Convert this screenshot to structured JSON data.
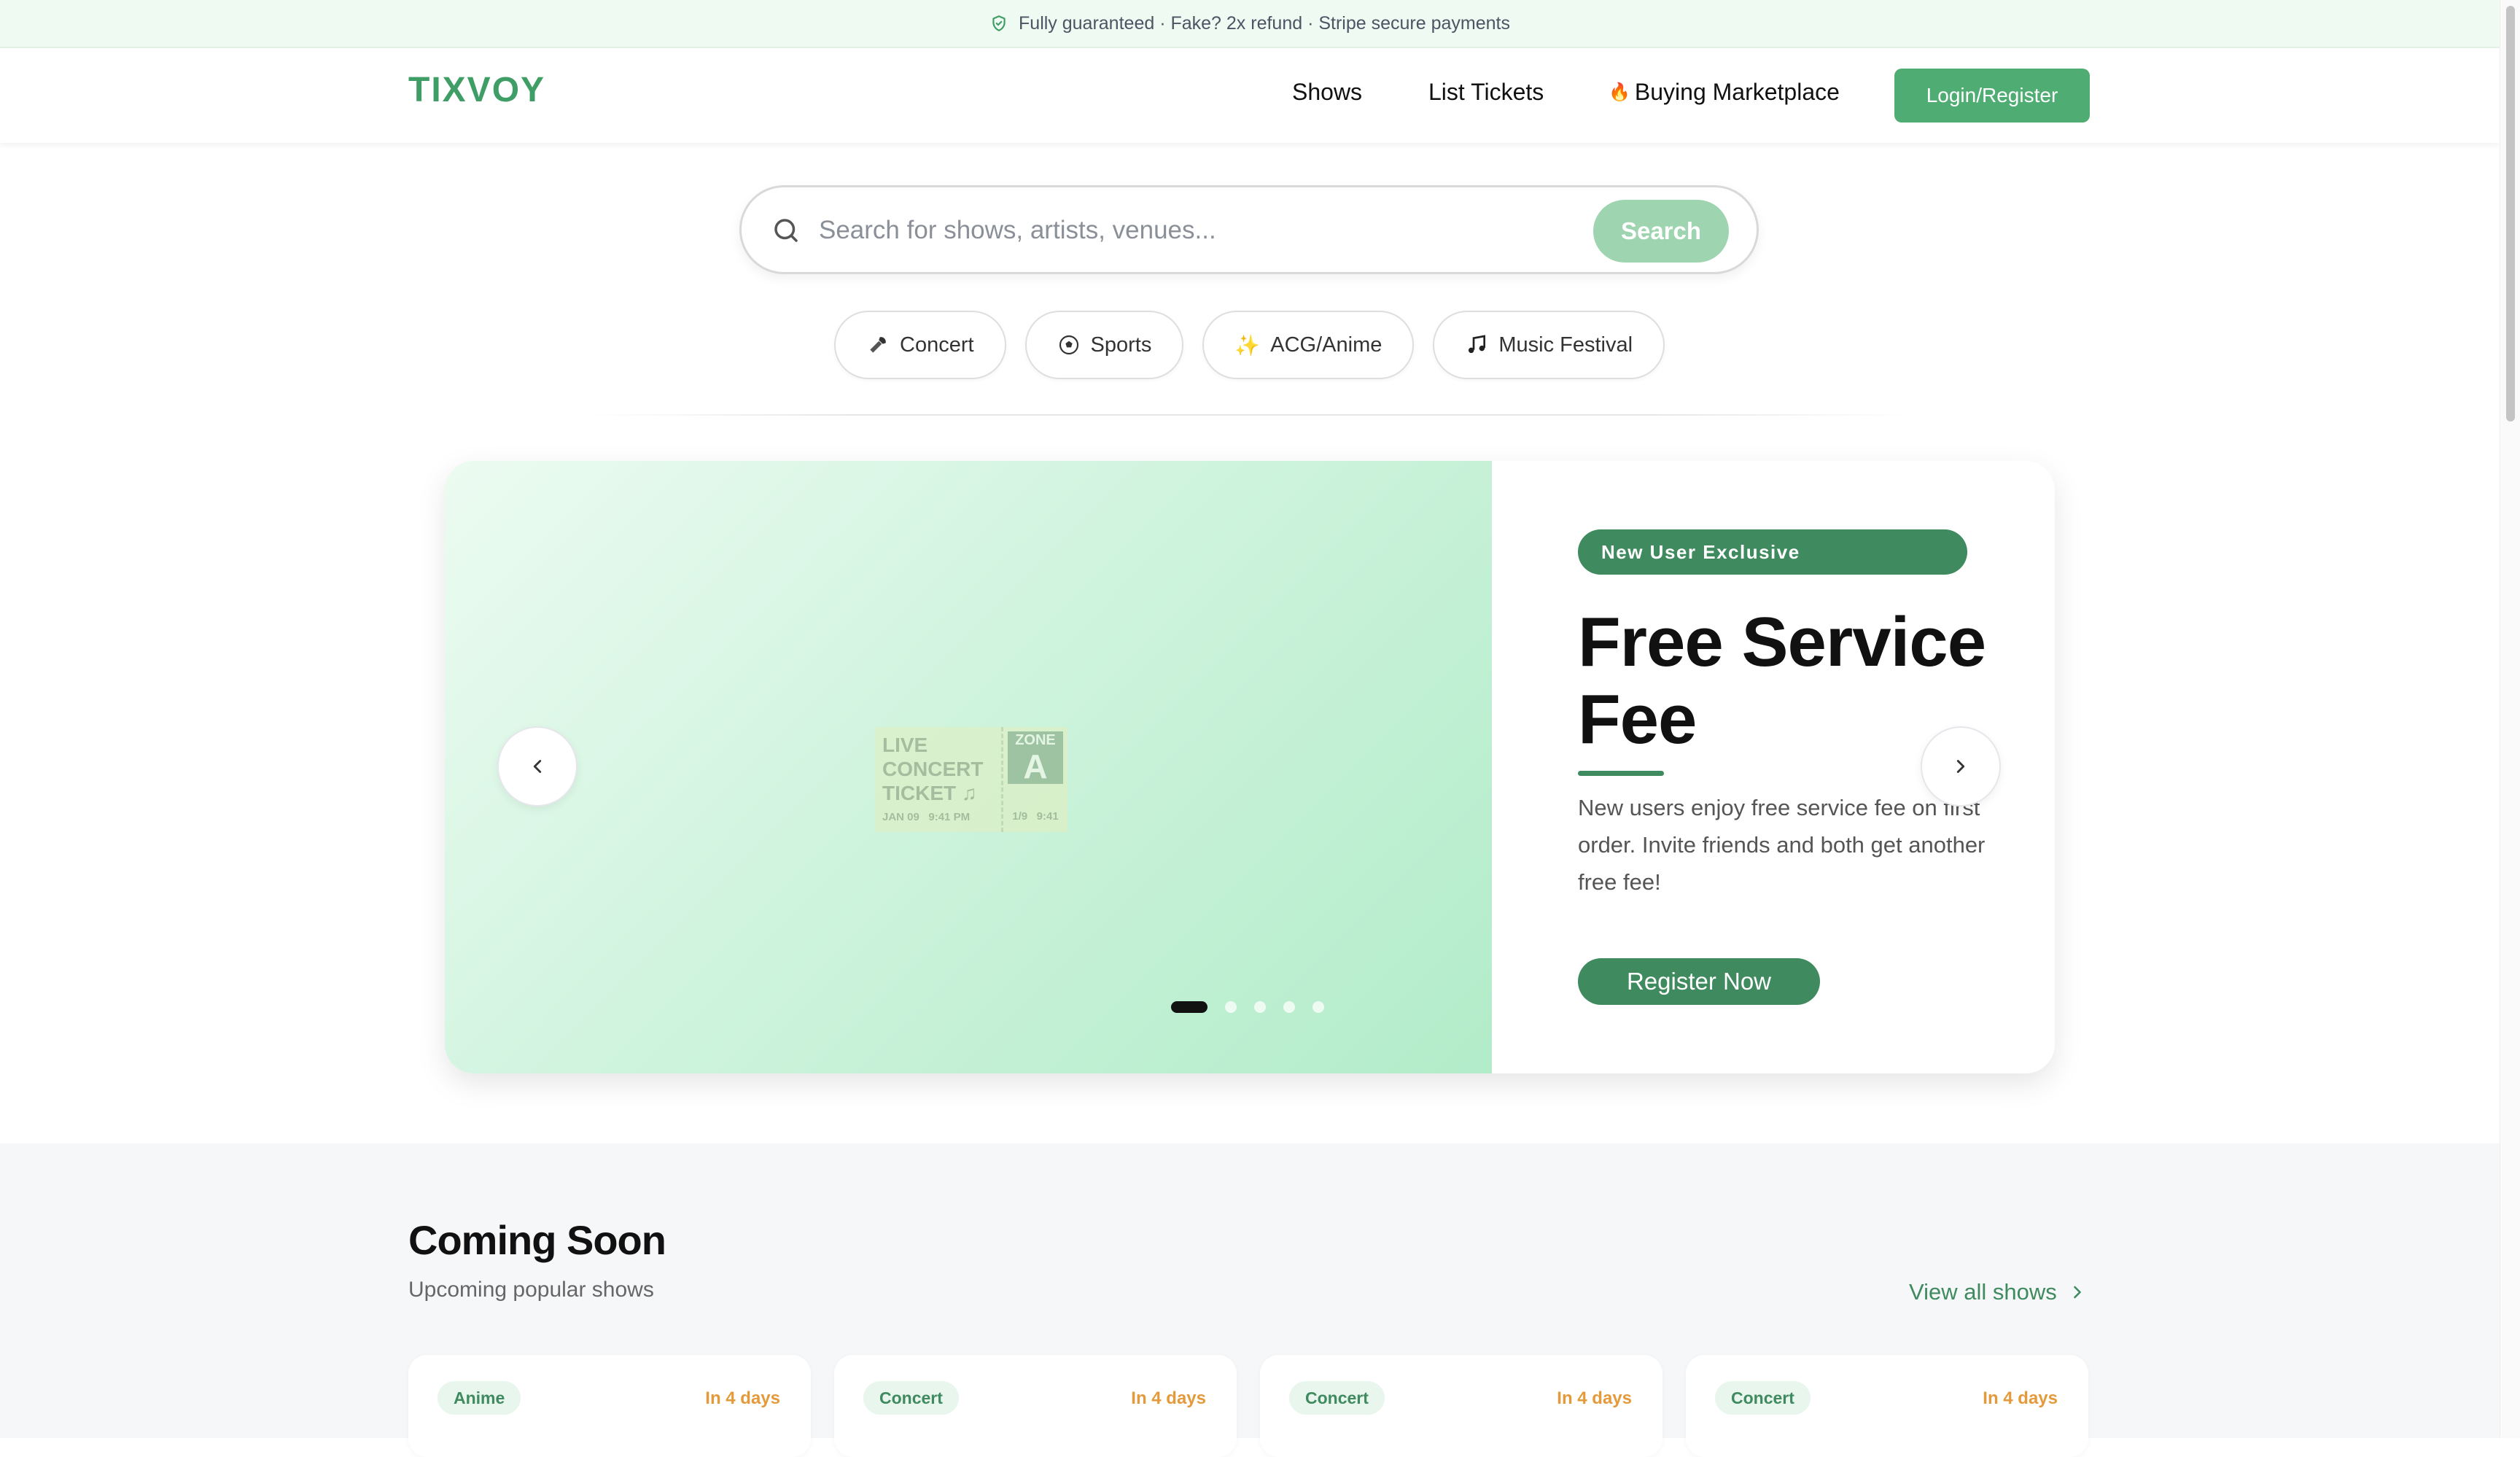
{
  "banner": {
    "text": "Fully guaranteed · Fake? 2x refund · Stripe secure payments",
    "icon": "shield-check-icon"
  },
  "header": {
    "logo": "TIXVOY",
    "nav": [
      {
        "label": "Shows"
      },
      {
        "label": "List Tickets"
      },
      {
        "label": "Buying Marketplace",
        "icon": "fire-icon"
      }
    ],
    "login_label": "Login/Register"
  },
  "search": {
    "placeholder": "Search for shows, artists, venues...",
    "button_label": "Search"
  },
  "categories": [
    {
      "label": "Concert",
      "icon": "microphone-icon"
    },
    {
      "label": "Sports",
      "icon": "soccer-ball-icon"
    },
    {
      "label": "ACG/Anime",
      "icon": "sparkles-icon"
    },
    {
      "label": "Music Festival",
      "icon": "music-note-icon"
    }
  ],
  "hero": {
    "ticket": {
      "line1": "LIVE",
      "line2": "CONCERT",
      "line3": "TICKET ♫",
      "date": "JAN 09",
      "time": "9:41 PM",
      "zone_label": "ZONE",
      "zone": "A",
      "stub_date": "1/9",
      "stub_time": "9:41"
    },
    "badge": "New User Exclusive",
    "title": "Free Service Fee",
    "description": "New users enjoy free service fee on first order. Invite friends and both get another free fee!",
    "cta_label": "Register Now",
    "slide_count": 5,
    "active_slide": 1
  },
  "coming_soon": {
    "title": "Coming Soon",
    "subtitle": "Upcoming popular shows",
    "view_all_label": "View all shows",
    "cards": [
      {
        "tag": "Anime",
        "days": "In 4 days"
      },
      {
        "tag": "Concert",
        "days": "In 4 days"
      },
      {
        "tag": "Concert",
        "days": "In 4 days"
      },
      {
        "tag": "Concert",
        "days": "In 4 days"
      }
    ]
  },
  "colors": {
    "brand": "#3f9d66",
    "accent_dark": "#3f8a5e",
    "countdown": "#e49a3a",
    "banner_bg": "#eefaf2"
  }
}
